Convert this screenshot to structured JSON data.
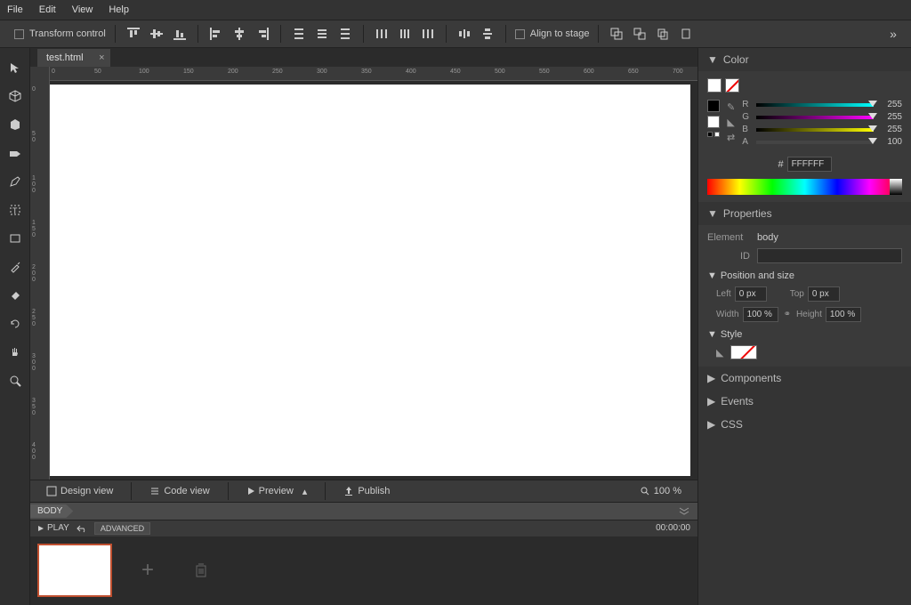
{
  "menu": {
    "file": "File",
    "edit": "Edit",
    "view": "View",
    "help": "Help"
  },
  "toolbar": {
    "transform_control": "Transform control",
    "align_to_stage": "Align to stage"
  },
  "tab": {
    "name": "test.html"
  },
  "status": {
    "design": "Design view",
    "code": "Code view",
    "preview": "Preview",
    "publish": "Publish",
    "zoom": "100 %"
  },
  "body_tag": "BODY",
  "play": {
    "label": "PLAY",
    "advanced": "ADVANCED",
    "time": "00:00:00"
  },
  "panels": {
    "color": {
      "title": "Color",
      "r": {
        "label": "R",
        "value": "255"
      },
      "g": {
        "label": "G",
        "value": "255"
      },
      "b": {
        "label": "B",
        "value": "255"
      },
      "a": {
        "label": "A",
        "value": "100"
      },
      "hex_prefix": "#",
      "hex": "FFFFFF"
    },
    "properties": {
      "title": "Properties",
      "element_label": "Element",
      "element_value": "body",
      "id_label": "ID",
      "id_value": "",
      "pos_size": "Position and size",
      "left_label": "Left",
      "left_value": "0 px",
      "top_label": "Top",
      "top_value": "0 px",
      "width_label": "Width",
      "width_value": "100 %",
      "height_label": "Height",
      "height_value": "100 %",
      "style": "Style"
    },
    "components": "Components",
    "events": "Events",
    "css": "CSS"
  }
}
